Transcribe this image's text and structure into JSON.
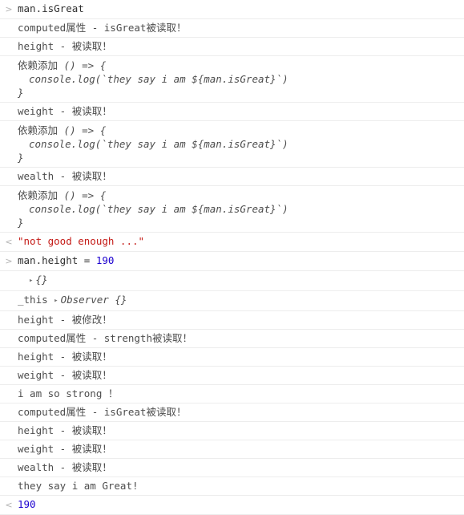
{
  "panel": {
    "name": "devtools-console",
    "gutter_input_marker": ">",
    "gutter_output_marker": "<",
    "expand_triangle": "▸",
    "colors": {
      "string": "#c41a16",
      "number": "#1c00cf",
      "text": "#303030",
      "log_text": "#4d4d4d",
      "gutter": "#b3b3b3",
      "row_border": "#ededed",
      "background": "#ffffff"
    }
  },
  "rows": [
    {
      "kind": "input",
      "marker": ">",
      "text": "man.isGreat"
    },
    {
      "kind": "log",
      "text": "computed属性 - isGreat被读取！"
    },
    {
      "kind": "log",
      "text": "height - 被读取！"
    },
    {
      "kind": "function",
      "label": "依赖添加",
      "line1": " () => {",
      "line2": "console.log(`they say i am ${man.isGreat}`)",
      "line3": "}"
    },
    {
      "kind": "log",
      "text": "weight - 被读取！"
    },
    {
      "kind": "function",
      "label": "依赖添加",
      "line1": " () => {",
      "line2": "console.log(`they say i am ${man.isGreat}`)",
      "line3": "}"
    },
    {
      "kind": "log",
      "text": "wealth - 被读取！"
    },
    {
      "kind": "function",
      "label": "依赖添加",
      "line1": " () => {",
      "line2": "console.log(`they say i am ${man.isGreat}`)",
      "line3": "}"
    },
    {
      "kind": "output-string",
      "marker": "<",
      "text": "\"not good enough ...\""
    },
    {
      "kind": "input-assign",
      "marker": ">",
      "expr": "man.height",
      "operator": "=",
      "value": "190"
    },
    {
      "kind": "object",
      "triangle": "▸",
      "text": "{}"
    },
    {
      "kind": "object-named",
      "name": "_this",
      "triangle": "▸",
      "text": "Observer {}"
    },
    {
      "kind": "log",
      "text": "height - 被修改！"
    },
    {
      "kind": "log",
      "text": "computed属性 - strength被读取！"
    },
    {
      "kind": "log",
      "text": "height - 被读取！"
    },
    {
      "kind": "log",
      "text": "weight - 被读取！"
    },
    {
      "kind": "log",
      "text": "i am so strong ！"
    },
    {
      "kind": "log",
      "text": "computed属性 - isGreat被读取！"
    },
    {
      "kind": "log",
      "text": "height - 被读取！"
    },
    {
      "kind": "log",
      "text": "weight - 被读取！"
    },
    {
      "kind": "log",
      "text": "wealth - 被读取！"
    },
    {
      "kind": "log",
      "text": "they say i am Great!"
    },
    {
      "kind": "output-number",
      "marker": "<",
      "text": "190"
    }
  ]
}
